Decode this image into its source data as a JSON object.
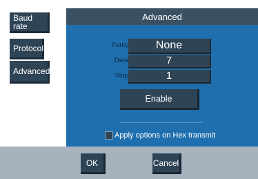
{
  "sidebar": {
    "baud_rate": "Baud rate",
    "protocol": "Protocol",
    "advanced": "Advanced"
  },
  "panel": {
    "title": "Advanced",
    "rows": [
      {
        "label": "Parity",
        "value": "None"
      },
      {
        "label": "Data",
        "value": "7"
      },
      {
        "label": "Stop",
        "value": "1"
      }
    ],
    "enable_label": "Enable",
    "hex_option_label": "Apply options on Hex transmit",
    "hex_option_checked": false
  },
  "footer": {
    "ok_label": "OK",
    "cancel_label": "Cancel"
  },
  "colors": {
    "panel_bg": "#1f6fae",
    "button_bg": "#2f4455",
    "footer_bg": "#a6b2be"
  }
}
